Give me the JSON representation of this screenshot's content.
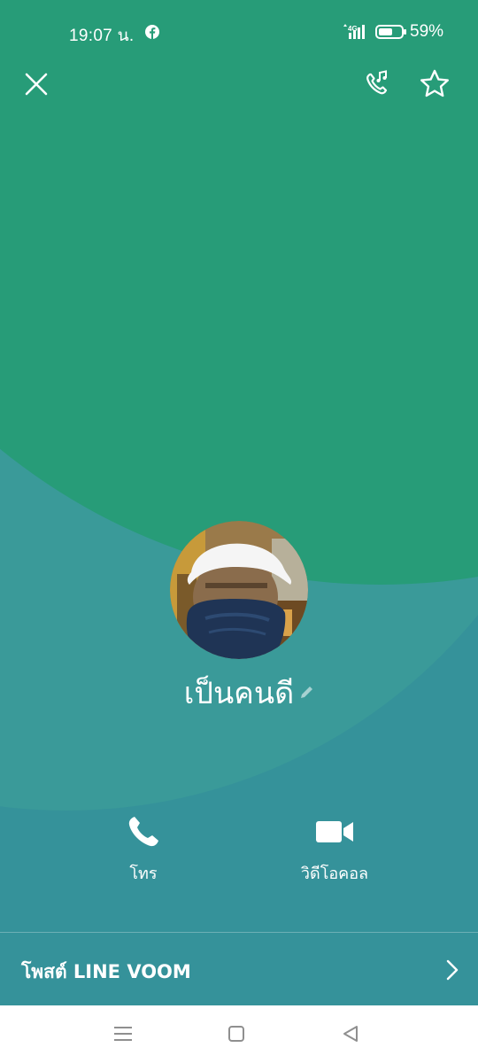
{
  "status_bar": {
    "time": "19:07 น.",
    "network": "4G",
    "battery": "59%",
    "icons": [
      "facebook-icon",
      "signal-icon",
      "battery-icon"
    ]
  },
  "top_actions": {
    "close": "close-icon",
    "voice_call_effects": "phone-music-icon",
    "favorite": "star-outline-icon"
  },
  "profile": {
    "name": "เป็นคนดี"
  },
  "actions": {
    "call_label": "โทร",
    "video_label": "วิดีโอคอล"
  },
  "voom": {
    "label": "โพสต์ LINE VOOM"
  },
  "colors": {
    "top_green": "#279c78",
    "teal_mid": "#3a9a99",
    "teal_bottom": "#35929a",
    "nav_bg": "#ffffff"
  }
}
